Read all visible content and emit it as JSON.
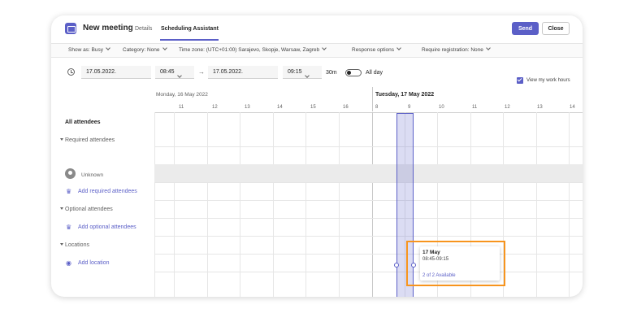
{
  "header": {
    "title": "New meeting",
    "tabs": [
      "Details",
      "Scheduling Assistant"
    ],
    "send_label": "Send",
    "close_label": "Close"
  },
  "options": {
    "show_as": "Show as: Busy",
    "category": "Category: None",
    "time_zone": "Time zone: (UTC+01:00) Sarajevo, Skopje, Warsaw, Zagreb",
    "response": "Response options",
    "registration": "Require registration: None"
  },
  "time": {
    "start_date": "17.05.2022.",
    "start_time": "08:45",
    "end_date": "17.05.2022.",
    "end_time": "09:15",
    "duration": "30m",
    "all_day": "All day",
    "work_hours": "View my work hours"
  },
  "schedule": {
    "day1": "Monday, 16 May 2022",
    "day2": "Tuesday, 17 May 2022",
    "hours": [
      "11",
      "12",
      "13",
      "14",
      "15",
      "16",
      "8",
      "9",
      "10",
      "11",
      "12",
      "13",
      "14"
    ]
  },
  "attendees": {
    "all": "All attendees",
    "required": "Required attendees",
    "unknown": "Unknown",
    "add_required": "Add required attendees",
    "optional": "Optional attendees",
    "add_optional": "Add optional attendees",
    "locations": "Locations",
    "add_location": "Add location"
  },
  "popup": {
    "date": "17 May",
    "time": "08:45-09:15",
    "availability": "2 of 2 Available"
  },
  "colors": {
    "accent": "#5b5fc7",
    "highlight": "#f7941d"
  }
}
